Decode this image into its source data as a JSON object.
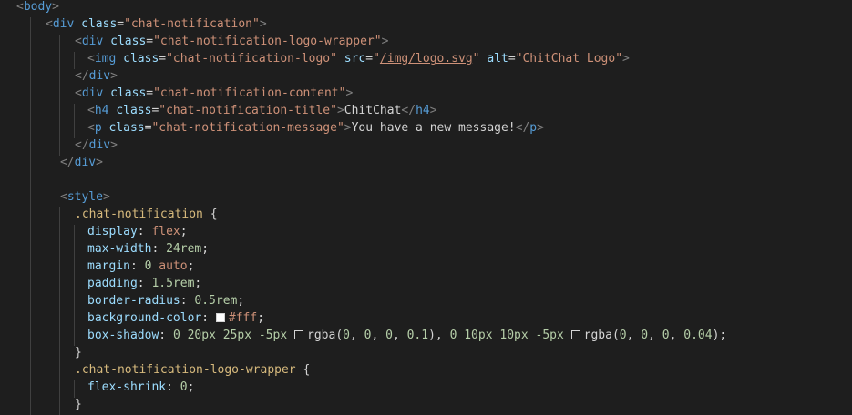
{
  "editor": {
    "language": "html",
    "lines": [
      [
        {
          "t": "<",
          "c": "t-punc"
        },
        {
          "t": "body",
          "c": "t-tag"
        },
        {
          "t": ">",
          "c": "t-punc"
        }
      ],
      [
        {
          "t": "<",
          "c": "t-punc"
        },
        {
          "t": "div",
          "c": "t-tag"
        },
        {
          "t": " "
        },
        {
          "t": "class",
          "c": "t-attr"
        },
        {
          "t": "=",
          "c": "t-text"
        },
        {
          "t": "\"chat-notification\"",
          "c": "t-str"
        },
        {
          "t": ">",
          "c": "t-punc"
        }
      ],
      [
        {
          "t": "<",
          "c": "t-punc"
        },
        {
          "t": "div",
          "c": "t-tag"
        },
        {
          "t": " "
        },
        {
          "t": "class",
          "c": "t-attr"
        },
        {
          "t": "=",
          "c": "t-text"
        },
        {
          "t": "\"chat-notification-logo-wrapper\"",
          "c": "t-str"
        },
        {
          "t": ">",
          "c": "t-punc"
        }
      ],
      [
        {
          "t": "<",
          "c": "t-punc"
        },
        {
          "t": "img",
          "c": "t-tag"
        },
        {
          "t": " "
        },
        {
          "t": "class",
          "c": "t-attr"
        },
        {
          "t": "=",
          "c": "t-text"
        },
        {
          "t": "\"chat-notification-logo\"",
          "c": "t-str"
        },
        {
          "t": " "
        },
        {
          "t": "src",
          "c": "t-attr"
        },
        {
          "t": "=",
          "c": "t-text"
        },
        {
          "t": "\"",
          "c": "t-str"
        },
        {
          "t": "/img/logo.svg",
          "c": "t-url"
        },
        {
          "t": "\"",
          "c": "t-str"
        },
        {
          "t": " "
        },
        {
          "t": "alt",
          "c": "t-attr"
        },
        {
          "t": "=",
          "c": "t-text"
        },
        {
          "t": "\"ChitChat Logo\"",
          "c": "t-str"
        },
        {
          "t": ">",
          "c": "t-punc"
        }
      ],
      [
        {
          "t": "</",
          "c": "t-punc"
        },
        {
          "t": "div",
          "c": "t-tag"
        },
        {
          "t": ">",
          "c": "t-punc"
        }
      ],
      [
        {
          "t": "<",
          "c": "t-punc"
        },
        {
          "t": "div",
          "c": "t-tag"
        },
        {
          "t": " "
        },
        {
          "t": "class",
          "c": "t-attr"
        },
        {
          "t": "=",
          "c": "t-text"
        },
        {
          "t": "\"chat-notification-content\"",
          "c": "t-str"
        },
        {
          "t": ">",
          "c": "t-punc"
        }
      ],
      [
        {
          "t": "<",
          "c": "t-punc"
        },
        {
          "t": "h4",
          "c": "t-tag"
        },
        {
          "t": " "
        },
        {
          "t": "class",
          "c": "t-attr"
        },
        {
          "t": "=",
          "c": "t-text"
        },
        {
          "t": "\"chat-notification-title\"",
          "c": "t-str"
        },
        {
          "t": ">",
          "c": "t-punc"
        },
        {
          "t": "ChitChat",
          "c": "t-text"
        },
        {
          "t": "</",
          "c": "t-punc"
        },
        {
          "t": "h4",
          "c": "t-tag"
        },
        {
          "t": ">",
          "c": "t-punc"
        }
      ],
      [
        {
          "t": "<",
          "c": "t-punc"
        },
        {
          "t": "p",
          "c": "t-tag"
        },
        {
          "t": " "
        },
        {
          "t": "class",
          "c": "t-attr"
        },
        {
          "t": "=",
          "c": "t-text"
        },
        {
          "t": "\"chat-notification-message\"",
          "c": "t-str"
        },
        {
          "t": ">",
          "c": "t-punc"
        },
        {
          "t": "You have a new message!",
          "c": "t-text"
        },
        {
          "t": "</",
          "c": "t-punc"
        },
        {
          "t": "p",
          "c": "t-tag"
        },
        {
          "t": ">",
          "c": "t-punc"
        }
      ],
      [
        {
          "t": "</",
          "c": "t-punc"
        },
        {
          "t": "div",
          "c": "t-tag"
        },
        {
          "t": ">",
          "c": "t-punc"
        }
      ],
      [
        {
          "t": "</",
          "c": "t-punc"
        },
        {
          "t": "div",
          "c": "t-tag"
        },
        {
          "t": ">",
          "c": "t-punc"
        }
      ],
      [],
      [
        {
          "t": "<",
          "c": "t-punc"
        },
        {
          "t": "style",
          "c": "t-tag"
        },
        {
          "t": ">",
          "c": "t-punc"
        }
      ],
      [
        {
          "t": ".chat-notification",
          "c": "t-sel"
        },
        {
          "t": " {",
          "c": "t-text"
        }
      ],
      [
        {
          "t": "display",
          "c": "t-prop"
        },
        {
          "t": ": ",
          "c": "t-text"
        },
        {
          "t": "flex",
          "c": "t-val"
        },
        {
          "t": ";",
          "c": "t-text"
        }
      ],
      [
        {
          "t": "max-width",
          "c": "t-prop"
        },
        {
          "t": ": ",
          "c": "t-text"
        },
        {
          "t": "24rem",
          "c": "t-num"
        },
        {
          "t": ";",
          "c": "t-text"
        }
      ],
      [
        {
          "t": "margin",
          "c": "t-prop"
        },
        {
          "t": ": ",
          "c": "t-text"
        },
        {
          "t": "0",
          "c": "t-num"
        },
        {
          "t": " "
        },
        {
          "t": "auto",
          "c": "t-val"
        },
        {
          "t": ";",
          "c": "t-text"
        }
      ],
      [
        {
          "t": "padding",
          "c": "t-prop"
        },
        {
          "t": ": ",
          "c": "t-text"
        },
        {
          "t": "1.5rem",
          "c": "t-num"
        },
        {
          "t": ";",
          "c": "t-text"
        }
      ],
      [
        {
          "t": "border-radius",
          "c": "t-prop"
        },
        {
          "t": ": ",
          "c": "t-text"
        },
        {
          "t": "0.5rem",
          "c": "t-num"
        },
        {
          "t": ";",
          "c": "t-text"
        }
      ],
      [
        {
          "t": "background-color",
          "c": "t-prop"
        },
        {
          "t": ": ",
          "c": "t-text"
        },
        {
          "sw": "white"
        },
        {
          "t": "#fff",
          "c": "t-val"
        },
        {
          "t": ";",
          "c": "t-text"
        }
      ],
      [
        {
          "t": "box-shadow",
          "c": "t-prop"
        },
        {
          "t": ": ",
          "c": "t-text"
        },
        {
          "t": "0",
          "c": "t-num"
        },
        {
          "t": " "
        },
        {
          "t": "20px",
          "c": "t-num"
        },
        {
          "t": " "
        },
        {
          "t": "25px",
          "c": "t-num"
        },
        {
          "t": " "
        },
        {
          "t": "-5px",
          "c": "t-num"
        },
        {
          "t": " "
        },
        {
          "sw": "clear"
        },
        {
          "t": "rgba(",
          "c": "t-text"
        },
        {
          "t": "0",
          "c": "t-num"
        },
        {
          "t": ", ",
          "c": "t-text"
        },
        {
          "t": "0",
          "c": "t-num"
        },
        {
          "t": ", ",
          "c": "t-text"
        },
        {
          "t": "0",
          "c": "t-num"
        },
        {
          "t": ", ",
          "c": "t-text"
        },
        {
          "t": "0.1",
          "c": "t-num"
        },
        {
          "t": "), ",
          "c": "t-text"
        },
        {
          "t": "0",
          "c": "t-num"
        },
        {
          "t": " "
        },
        {
          "t": "10px",
          "c": "t-num"
        },
        {
          "t": " "
        },
        {
          "t": "10px",
          "c": "t-num"
        },
        {
          "t": " "
        },
        {
          "t": "-5px",
          "c": "t-num"
        },
        {
          "t": " "
        },
        {
          "sw": "clear"
        },
        {
          "t": "rgba(",
          "c": "t-text"
        },
        {
          "t": "0",
          "c": "t-num"
        },
        {
          "t": ", ",
          "c": "t-text"
        },
        {
          "t": "0",
          "c": "t-num"
        },
        {
          "t": ", ",
          "c": "t-text"
        },
        {
          "t": "0",
          "c": "t-num"
        },
        {
          "t": ", ",
          "c": "t-text"
        },
        {
          "t": "0.04",
          "c": "t-num"
        },
        {
          "t": ");",
          "c": "t-text"
        }
      ],
      [
        {
          "t": "}",
          "c": "t-text"
        }
      ],
      [
        {
          "t": ".chat-notification-logo-wrapper",
          "c": "t-sel"
        },
        {
          "t": " {",
          "c": "t-text"
        }
      ],
      [
        {
          "t": "flex-shrink",
          "c": "t-prop"
        },
        {
          "t": ": ",
          "c": "t-text"
        },
        {
          "t": "0",
          "c": "t-num"
        },
        {
          "t": ";",
          "c": "t-text"
        }
      ],
      [
        {
          "t": "}",
          "c": "t-text"
        }
      ]
    ]
  }
}
